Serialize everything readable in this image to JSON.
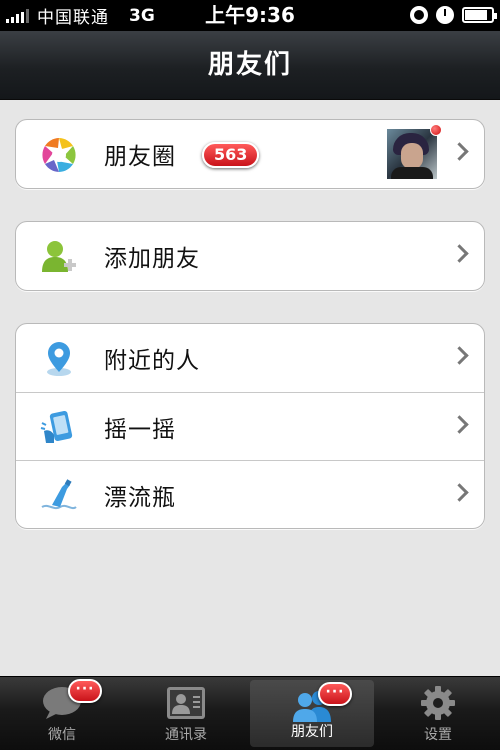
{
  "status_bar": {
    "carrier": "中国联通",
    "network": "3G",
    "time": "上午9:36",
    "icons": [
      "signal-icon",
      "orientation-lock-icon",
      "alarm-icon",
      "battery-icon"
    ]
  },
  "nav": {
    "title": "朋友们"
  },
  "rows": {
    "moments": {
      "label": "朋友圈",
      "badge": "563",
      "icon": "moments-aperture-icon"
    },
    "add_friend": {
      "label": "添加朋友",
      "icon": "add-friend-icon"
    },
    "nearby": {
      "label": "附近的人",
      "icon": "location-pin-icon"
    },
    "shake": {
      "label": "摇一摇",
      "icon": "shake-phone-icon"
    },
    "bottle": {
      "label": "漂流瓶",
      "icon": "drift-bottle-icon"
    }
  },
  "tabs": [
    {
      "label": "微信",
      "badge": "···",
      "icon": "chat-bubble-icon",
      "active": false
    },
    {
      "label": "通讯录",
      "icon": "contacts-card-icon",
      "active": false
    },
    {
      "label": "朋友们",
      "badge": "···",
      "icon": "friends-icon",
      "active": true
    },
    {
      "label": "设置",
      "icon": "gear-icon",
      "active": false
    }
  ],
  "colors": {
    "badge_red": "#d0151c",
    "nav_bg": "#1d2023",
    "page_bg": "#e6e6e6",
    "friends_blue": "#2a8ad4"
  }
}
